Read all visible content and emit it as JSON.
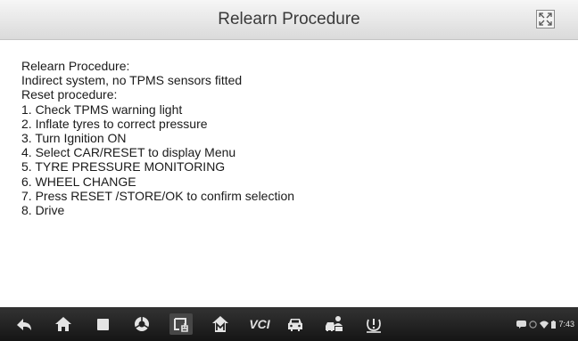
{
  "title": "Relearn Procedure",
  "icons": {
    "fullscreen": "fullscreen-toggle-icon"
  },
  "content": {
    "lines": [
      "Relearn Procedure:",
      "Indirect system, no TPMS sensors fitted",
      "Reset procedure:",
      "1. Check TPMS warning light",
      "2. Inflate tyres to correct pressure",
      "3. Turn Ignition ON",
      "4. Select CAR/RESET to display Menu",
      "5. TYRE PRESSURE MONITORING",
      "6. WHEEL CHANGE",
      "7. Press RESET /STORE/OK to confirm selection",
      "8. Drive"
    ]
  },
  "navbar": {
    "items": [
      {
        "name": "back",
        "icon": "back-arrow-icon"
      },
      {
        "name": "home",
        "icon": "home-icon"
      },
      {
        "name": "recent-apps",
        "icon": "recent-apps-icon"
      },
      {
        "name": "browser",
        "icon": "browser-icon"
      },
      {
        "name": "screenshot",
        "icon": "screenshot-icon"
      },
      {
        "name": "maxifix",
        "icon": "maxifix-icon"
      },
      {
        "name": "vci",
        "icon": "vci-icon",
        "label": "VCI"
      },
      {
        "name": "vehicle",
        "icon": "car-icon"
      },
      {
        "name": "vehicle-user",
        "icon": "car-user-icon"
      },
      {
        "name": "tpms",
        "icon": "tpms-icon"
      }
    ]
  },
  "status": {
    "time": "7:43",
    "icons": [
      "message-icon",
      "alarm-icon",
      "wifi-icon",
      "battery-icon"
    ]
  },
  "colors": {
    "titlebar": "#e8e8e8",
    "navbar": "#1e1e1e",
    "text": "#1a1a1a"
  }
}
